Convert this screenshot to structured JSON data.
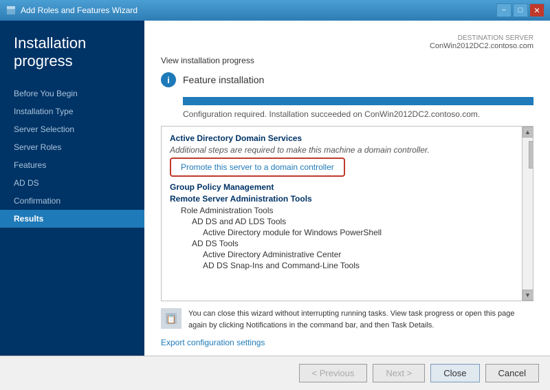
{
  "titleBar": {
    "title": "Add Roles and Features Wizard",
    "icon": "wizard-icon",
    "buttons": {
      "minimize": "−",
      "restore": "□",
      "close": "✕"
    }
  },
  "sidebar": {
    "title": "Installation progress",
    "items": [
      {
        "id": "before-you-begin",
        "label": "Before You Begin"
      },
      {
        "id": "installation-type",
        "label": "Installation Type"
      },
      {
        "id": "server-selection",
        "label": "Server Selection"
      },
      {
        "id": "server-roles",
        "label": "Server Roles"
      },
      {
        "id": "features",
        "label": "Features"
      },
      {
        "id": "ad-ds",
        "label": "AD DS"
      },
      {
        "id": "confirmation",
        "label": "Confirmation"
      },
      {
        "id": "results",
        "label": "Results"
      }
    ],
    "activeItem": "results"
  },
  "destinationServer": {
    "label": "DESTINATION SERVER",
    "value": "ConWin2012DC2.contoso.com"
  },
  "mainContent": {
    "sectionTitle": "View installation progress",
    "featureInstall": {
      "icon": "i",
      "label": "Feature installation"
    },
    "progressPercent": 100,
    "successText": "Configuration required. Installation succeeded on ConWin2012DC2.contoso.com.",
    "featureList": {
      "sections": [
        {
          "header": "Active Directory Domain Services",
          "items": [
            {
              "text": "Additional steps are required to make this machine a domain controller.",
              "indent": 0,
              "italic": true
            },
            {
              "text": "Promote this server to a domain controller",
              "indent": 0,
              "isLink": true
            }
          ]
        },
        {
          "header": "Group Policy Management",
          "items": []
        },
        {
          "header": "Remote Server Administration Tools",
          "items": [
            {
              "text": "Role Administration Tools",
              "indent": 1
            },
            {
              "text": "AD DS and AD LDS Tools",
              "indent": 2
            },
            {
              "text": "Active Directory module for Windows PowerShell",
              "indent": 3
            },
            {
              "text": "AD DS Tools",
              "indent": 2
            },
            {
              "text": "Active Directory Administrative Center",
              "indent": 3
            },
            {
              "text": "AD DS Snap-Ins and Command-Line Tools",
              "indent": 3
            }
          ]
        }
      ]
    },
    "notice": {
      "text": "You can close this wizard without interrupting running tasks. View task progress or open this page again by clicking Notifications in the command bar, and then Task Details."
    },
    "exportLink": "Export configuration settings"
  },
  "footer": {
    "previousLabel": "< Previous",
    "nextLabel": "Next >",
    "closeLabel": "Close",
    "cancelLabel": "Cancel"
  }
}
